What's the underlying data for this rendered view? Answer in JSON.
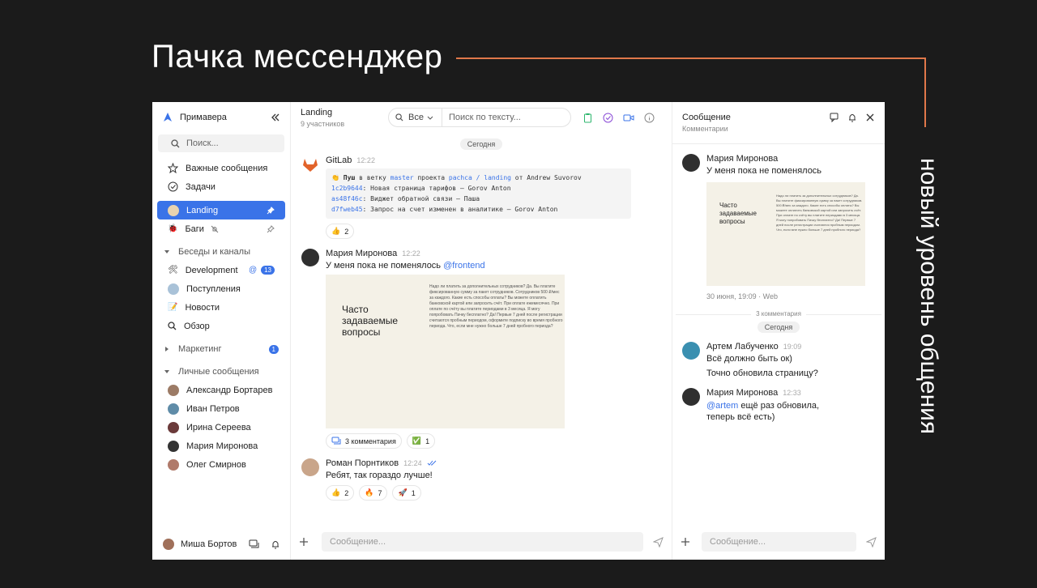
{
  "hero": {
    "title": "Пачка мессенджер",
    "vertical": "новый уровень общения"
  },
  "sidebar": {
    "workspace": "Примавера",
    "search_placeholder": "Поиск...",
    "top_items": [
      "Важные сообщения",
      "Задачи"
    ],
    "chats": [
      {
        "label": "Landing"
      },
      {
        "label": "Баги"
      }
    ],
    "channels_section": "Беседы и каналы",
    "channels": [
      {
        "label": "Development",
        "count": "13"
      },
      {
        "label": "Поступления"
      },
      {
        "label": "Новости"
      },
      {
        "label": "Обзор"
      }
    ],
    "marketing": {
      "label": "Маркетинг",
      "count": "1"
    },
    "dm_section": "Личные сообщения",
    "dms": [
      "Александр Бортарев",
      "Иван Петров",
      "Ирина Сереева",
      "Мария Миронова",
      "Олег Смирнов"
    ],
    "user": "Миша Бортов"
  },
  "chat": {
    "title": "Landing",
    "subtitle": "9 участников",
    "filter": "Все",
    "search_placeholder": "Поиск по тексту...",
    "date": "Сегодня",
    "gitlab": {
      "author": "GitLab",
      "time": "12:22",
      "push_prefix": "Пуш",
      "push_mid1": "в ветку",
      "branch": "master",
      "push_mid2": "проекта",
      "project": "pachca / landing",
      "push_mid3": "от Andrew Suvorov",
      "commits": [
        {
          "hash": "1c2b9644",
          "text": ": Новая страница тарифов – Gorov Anton"
        },
        {
          "hash": "as48f46c",
          "text": ": Виджет обратной связи – Паша"
        },
        {
          "hash": "d7fweb45",
          "text": ": Запрос на счет изменен в аналитике – Gorov Anton"
        }
      ],
      "reaction_count": "2"
    },
    "maria": {
      "author": "Мария Миронова",
      "time": "12:22",
      "text": "У меня пока не поменялось",
      "mention": "@frontend",
      "faq_title": "Часто задаваемые вопросы",
      "faq_text": "Надо ли платить за дополнительных сотрудников? Да. Вы платите фиксированную сумму за пакет сотрудников. Сотрудников 500 ₽/мес за каждого. Какие есть способы оплаты? Вы можете оплатить банковской картой или запросить счёт. При оплате ежемесячно. При оплате по счёту вы платите периодами в 3 месяца. Я могу попробовать Пачку бесплатно? Да! Первые 7 дней после регистрации считаются пробным периодом, оформите подписку во время пробного периода. Что, если мне нужно больше 7 дней пробного периода?",
      "comments": "3 комментария",
      "check_count": "1"
    },
    "roman": {
      "author": "Роман Порнтиков",
      "time": "12:24",
      "text": "Ребят, так гораздо лучше!",
      "reactions": [
        {
          "emoji": "👍",
          "count": "2"
        },
        {
          "emoji": "🔥",
          "count": "7"
        },
        {
          "emoji": "🚀",
          "count": "1"
        }
      ]
    },
    "composer_placeholder": "Сообщение..."
  },
  "thread": {
    "title": "Сообщение",
    "subtitle": "Комментарии",
    "root": {
      "author": "Мария Миронова",
      "text": "У меня пока не поменялось",
      "meta": "30 июня, 19:09 · Web"
    },
    "faq_title": "Часто задаваемые вопросы",
    "faq_text": "Надо ли платить за дополнительных сотрудников? Да. Вы платите фиксированную сумму за пакет сотрудников. 500 ₽/мес за каждого. Какие есть способы оплаты? Вы можете оплатить банковской картой или запросить счёт. При оплате по счёту вы платите периодами в 3 месяца. Я могу попробовать Пачку бесплатно? Да! Первые 7 дней после регистрации считаются пробным периодом. Что, если мне нужно больше 7 дней пробного периода?",
    "count_label": "3 комментария",
    "date": "Сегодня",
    "replies": [
      {
        "author": "Артем Лабученко",
        "time": "19:09",
        "lines": [
          "Всё должно быть ок)",
          "Точно обновила страницу?"
        ]
      },
      {
        "author": "Мария Миронова",
        "time": "12:33",
        "mention": "@artem",
        "text": " ещё раз обновила, теперь всё есть)"
      }
    ],
    "composer_placeholder": "Сообщение..."
  },
  "colors": {
    "accent": "#3a73e8",
    "orange": "#e0784a",
    "bg": "#1b1b1b"
  }
}
